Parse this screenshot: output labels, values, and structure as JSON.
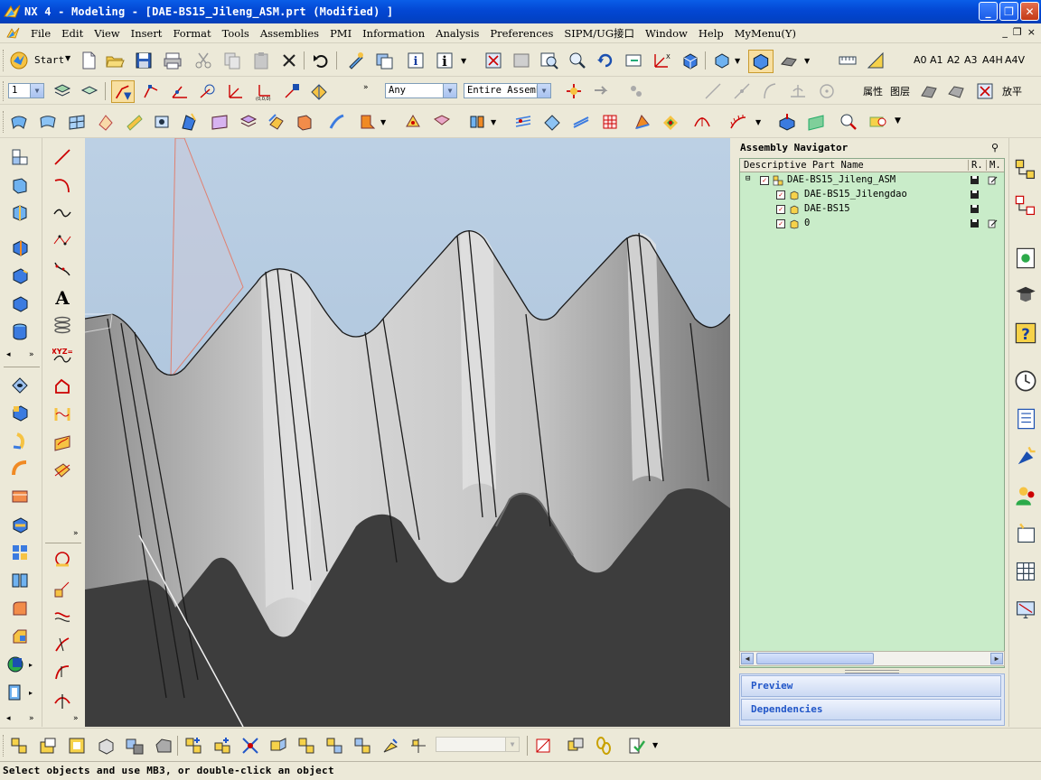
{
  "window": {
    "title": "NX 4 - Modeling - [DAE-BS15_Jileng_ASM.prt (Modified) ]",
    "controls": [
      "minimize",
      "maximize",
      "close"
    ]
  },
  "menubar": {
    "items": [
      "File",
      "Edit",
      "View",
      "Insert",
      "Format",
      "Tools",
      "Assemblies",
      "PMI",
      "Information",
      "Analysis",
      "Preferences",
      "SIPM/UG接口",
      "Window",
      "Help",
      "MyMenu(Y)"
    ],
    "mdi_controls": [
      "_",
      "restore",
      "×"
    ]
  },
  "toolbar1": {
    "start_label": "Start",
    "sheet_labels": [
      "A0",
      "A1",
      "A2",
      "A3",
      "A4H",
      "A4V"
    ]
  },
  "toolbar2": {
    "layer_value": "1",
    "filter_value": "Any",
    "scope_value": "Entire Assemb",
    "attr_label": "属性",
    "layer_label": "图层",
    "zoom_label": "放平"
  },
  "navigator": {
    "title": "Assembly Navigator",
    "columns": [
      "Descriptive Part Name",
      "R.",
      "M."
    ],
    "rows": [
      {
        "name": "DAE-BS15_Jileng_ASM",
        "level": 0,
        "checked": true,
        "modified": true
      },
      {
        "name": "DAE-BS15_Jilengdao",
        "level": 1,
        "checked": true,
        "modified": false
      },
      {
        "name": "DAE-BS15",
        "level": 1,
        "checked": true,
        "modified": false
      },
      {
        "name": "0",
        "level": 1,
        "checked": true,
        "modified": true
      }
    ],
    "panels": [
      "Preview",
      "Dependencies"
    ]
  },
  "statusbar": {
    "message": "Select objects and use MB3, or double-click an object"
  },
  "colors": {
    "title_blue": "#0347d3",
    "viewport_sky": "#a8c0da",
    "navigator_green": "#c9ecc9",
    "panel_blue": "#2156c8"
  }
}
